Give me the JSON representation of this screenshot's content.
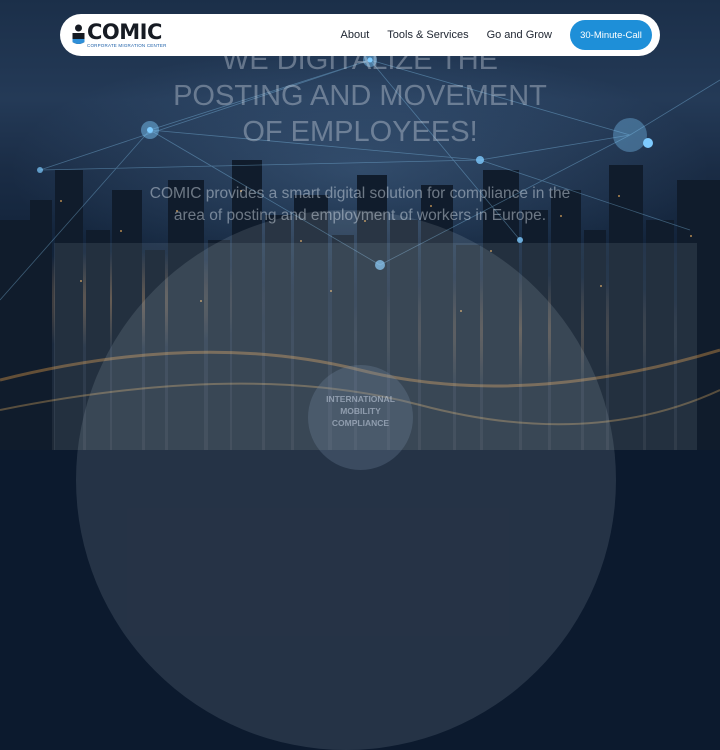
{
  "brand": {
    "name": "COMIC",
    "tagline": "CORPORATE MIGRATION CENTER"
  },
  "nav": {
    "links": [
      "About",
      "Tools & Services",
      "Go and Grow"
    ],
    "cta": "30-Minute-Call",
    "colors": {
      "cta": "#1e8fd8",
      "bar": "#ffffff"
    }
  },
  "hero": {
    "headline_lines": [
      "WE DIGITALIZE THE",
      "POSTING AND MOVEMENT",
      "OF EMPLOYEES!"
    ],
    "subtext_lines": [
      "COMIC provides a smart digital solution for compliance in the",
      "area of posting and employment of workers in Europe."
    ],
    "badge_lines": [
      "INTERNATIONAL",
      "MOBILITY",
      "COMPLIANCE"
    ]
  }
}
